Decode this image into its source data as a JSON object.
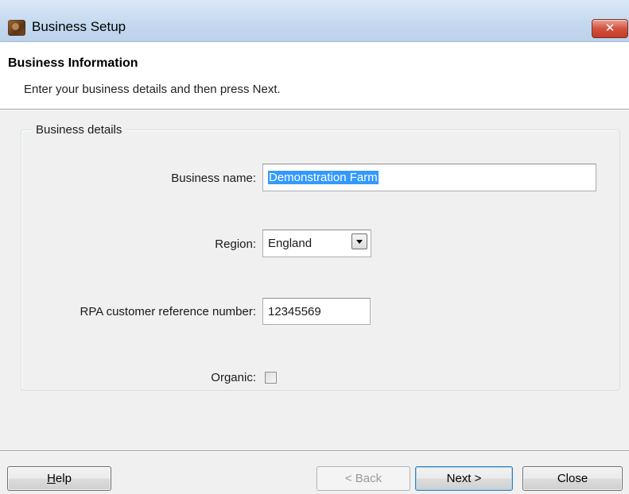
{
  "window": {
    "title": "Business Setup",
    "close_glyph": "✕"
  },
  "header": {
    "title": "Business Information",
    "description": "Enter your business details and then press Next."
  },
  "group": {
    "legend": "Business details",
    "fields": {
      "business_name": {
        "label": "Business name:",
        "value": "Demonstration Farm"
      },
      "region": {
        "label": "Region:",
        "value": "England"
      },
      "rpa": {
        "label": "RPA customer reference number:",
        "value": "12345569"
      },
      "organic": {
        "label": "Organic:",
        "checked": false
      }
    }
  },
  "buttons": {
    "help_mnemonic": "H",
    "help_rest": "elp",
    "back": "< Back",
    "next": "Next >",
    "close": "Close"
  }
}
